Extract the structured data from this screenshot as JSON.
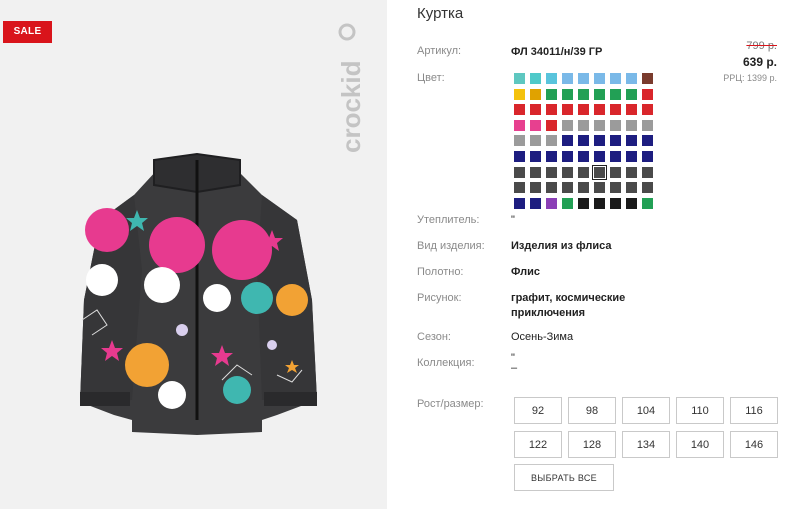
{
  "badge": {
    "sale": "SALE"
  },
  "brand": {
    "watermark": "crockid"
  },
  "product": {
    "title": "Куртка",
    "article_label": "Артикул:",
    "article_value": "ФЛ 34011/н/39 ГР",
    "color_label": "Цвет:",
    "insulation_label": "Утеплитель:",
    "insulation_value": "\"",
    "type_label": "Вид изделия:",
    "type_value": "Изделия из флиса",
    "fabric_label": "Полотно:",
    "fabric_value": "Флис",
    "pattern_label": "Рисунок:",
    "pattern_value": "графит, космические приключения",
    "season_label": "Сезон:",
    "season_value": "Осень-Зима",
    "collection_label": "Коллекция:",
    "collection_value_1": "\"",
    "collection_value_2": "–",
    "size_label": "Рост/размер:"
  },
  "price": {
    "old": "799 р.",
    "current": "639 р.",
    "rrp": "РРЦ: 1399 р."
  },
  "swatches": {
    "selected_index": 59,
    "colors": [
      "#5ec7c0",
      "#4fc9c9",
      "#59c4dc",
      "#7ab9e8",
      "#7ab9e8",
      "#7ab9e8",
      "#7ab9e8",
      "#7ab9e8",
      "#7a3b2d",
      "#f4c20d",
      "#e0a200",
      "#22a055",
      "#22a055",
      "#22a055",
      "#22a055",
      "#22a055",
      "#22a055",
      "#d9262b",
      "#d9262b",
      "#d9262b",
      "#d9262b",
      "#d9262b",
      "#d9262b",
      "#d9262b",
      "#d9262b",
      "#d9262b",
      "#d9262b",
      "#e7408f",
      "#e7408f",
      "#d9262b",
      "#9b9b9b",
      "#9b9b9b",
      "#9b9b9b",
      "#9b9b9b",
      "#9b9b9b",
      "#9b9b9b",
      "#9b9b9b",
      "#9b9b9b",
      "#9b9b9b",
      "#1d1d80",
      "#1d1d80",
      "#1d1d80",
      "#1d1d80",
      "#1d1d80",
      "#1d1d80",
      "#1d1d80",
      "#1d1d80",
      "#1d1d80",
      "#1d1d80",
      "#1d1d80",
      "#1d1d80",
      "#1d1d80",
      "#1d1d80",
      "#1d1d80",
      "#4a4a4a",
      "#4a4a4a",
      "#4a4a4a",
      "#4a4a4a",
      "#4a4a4a",
      "#4a4a4a",
      "#4a4a4a",
      "#4a4a4a",
      "#4a4a4a",
      "#4a4a4a",
      "#4a4a4a",
      "#4a4a4a",
      "#4a4a4a",
      "#4a4a4a",
      "#4a4a4a",
      "#4a4a4a",
      "#4a4a4a",
      "#4a4a4a",
      "#1d1d80",
      "#1d1d80",
      "#8b3fb6",
      "#22a055",
      "#1a1a1a",
      "#1a1a1a",
      "#1a1a1a",
      "#1a1a1a",
      "#22a055"
    ]
  },
  "sizes": [
    "92",
    "98",
    "104",
    "110",
    "116",
    "122",
    "128",
    "134",
    "140",
    "146"
  ],
  "buttons": {
    "select_all": "ВЫБРАТЬ ВСЕ"
  },
  "colors": {
    "sale_red": "#d9141b",
    "panel_bg": "#f1f1f1",
    "fleece": "#3b3b3d"
  }
}
